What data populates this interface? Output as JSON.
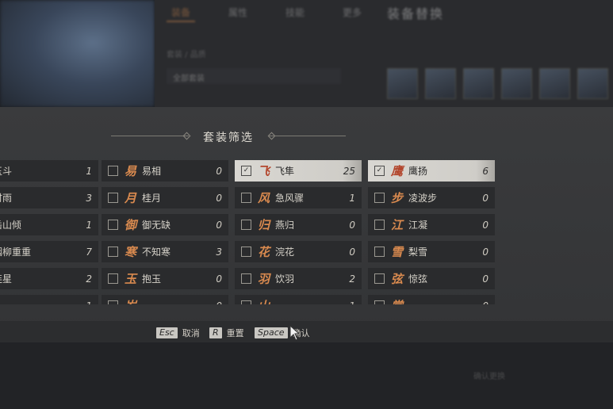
{
  "background": {
    "tabs": [
      "装备",
      "属性",
      "技能",
      "更多"
    ],
    "title": "装备替换",
    "filter_label": "套装 / 品质",
    "filter_value": "全部套装",
    "bottom_text": "确认更换"
  },
  "panel": {
    "title": "套装筛选"
  },
  "columns": [
    [
      {
        "glyph": "",
        "name": "玉斗",
        "count": "1",
        "checked": false
      },
      {
        "glyph": "",
        "name": "时雨",
        "count": "3",
        "checked": false
      },
      {
        "glyph": "",
        "name": "岳山倾",
        "count": "1",
        "checked": false
      },
      {
        "glyph": "",
        "name": "烟柳重重",
        "count": "7",
        "checked": false
      },
      {
        "glyph": "",
        "name": "连星",
        "count": "2",
        "checked": false
      },
      {
        "glyph": "",
        "name": "…",
        "count": "1",
        "checked": false
      }
    ],
    [
      {
        "glyph": "易",
        "name": "易相",
        "count": "0",
        "checked": false
      },
      {
        "glyph": "月",
        "name": "桂月",
        "count": "0",
        "checked": false
      },
      {
        "glyph": "御",
        "name": "御无缺",
        "count": "0",
        "checked": false
      },
      {
        "glyph": "寒",
        "name": "不知寒",
        "count": "3",
        "checked": false
      },
      {
        "glyph": "玉",
        "name": "抱玉",
        "count": "0",
        "checked": false
      },
      {
        "glyph": "岁",
        "name": "…",
        "count": "0",
        "checked": false
      }
    ],
    [
      {
        "glyph": "飞",
        "name": "飞隼",
        "count": "25",
        "checked": true
      },
      {
        "glyph": "风",
        "name": "急风骤",
        "count": "1",
        "checked": false
      },
      {
        "glyph": "归",
        "name": "燕归",
        "count": "0",
        "checked": false
      },
      {
        "glyph": "花",
        "name": "浣花",
        "count": "0",
        "checked": false
      },
      {
        "glyph": "羽",
        "name": "饮羽",
        "count": "2",
        "checked": false
      },
      {
        "glyph": "山",
        "name": "…",
        "count": "1",
        "checked": false
      }
    ],
    [
      {
        "glyph": "鹰",
        "name": "鹰扬",
        "count": "6",
        "checked": true
      },
      {
        "glyph": "步",
        "name": "凌波步",
        "count": "0",
        "checked": false
      },
      {
        "glyph": "江",
        "name": "江凝",
        "count": "0",
        "checked": false
      },
      {
        "glyph": "雪",
        "name": "梨雪",
        "count": "0",
        "checked": false
      },
      {
        "glyph": "弦",
        "name": "惊弦",
        "count": "0",
        "checked": false
      },
      {
        "glyph": "棠",
        "name": "…",
        "count": "0",
        "checked": false
      }
    ]
  ],
  "footer": {
    "hints": [
      {
        "key": "Esc",
        "label": "取消"
      },
      {
        "key": "R",
        "label": "重置"
      },
      {
        "key": "Space",
        "label": "确认"
      }
    ]
  },
  "colors": {
    "accent": "#d98a4f",
    "selected_row": "#d9d7d2",
    "panel_bg": "#3a3b3d",
    "cell_bg": "#2a2b2d"
  },
  "icons": [
    "checkbox-icon",
    "set-emblem-icon",
    "cursor-pointer-icon",
    "diamond-ornament-icon"
  ]
}
